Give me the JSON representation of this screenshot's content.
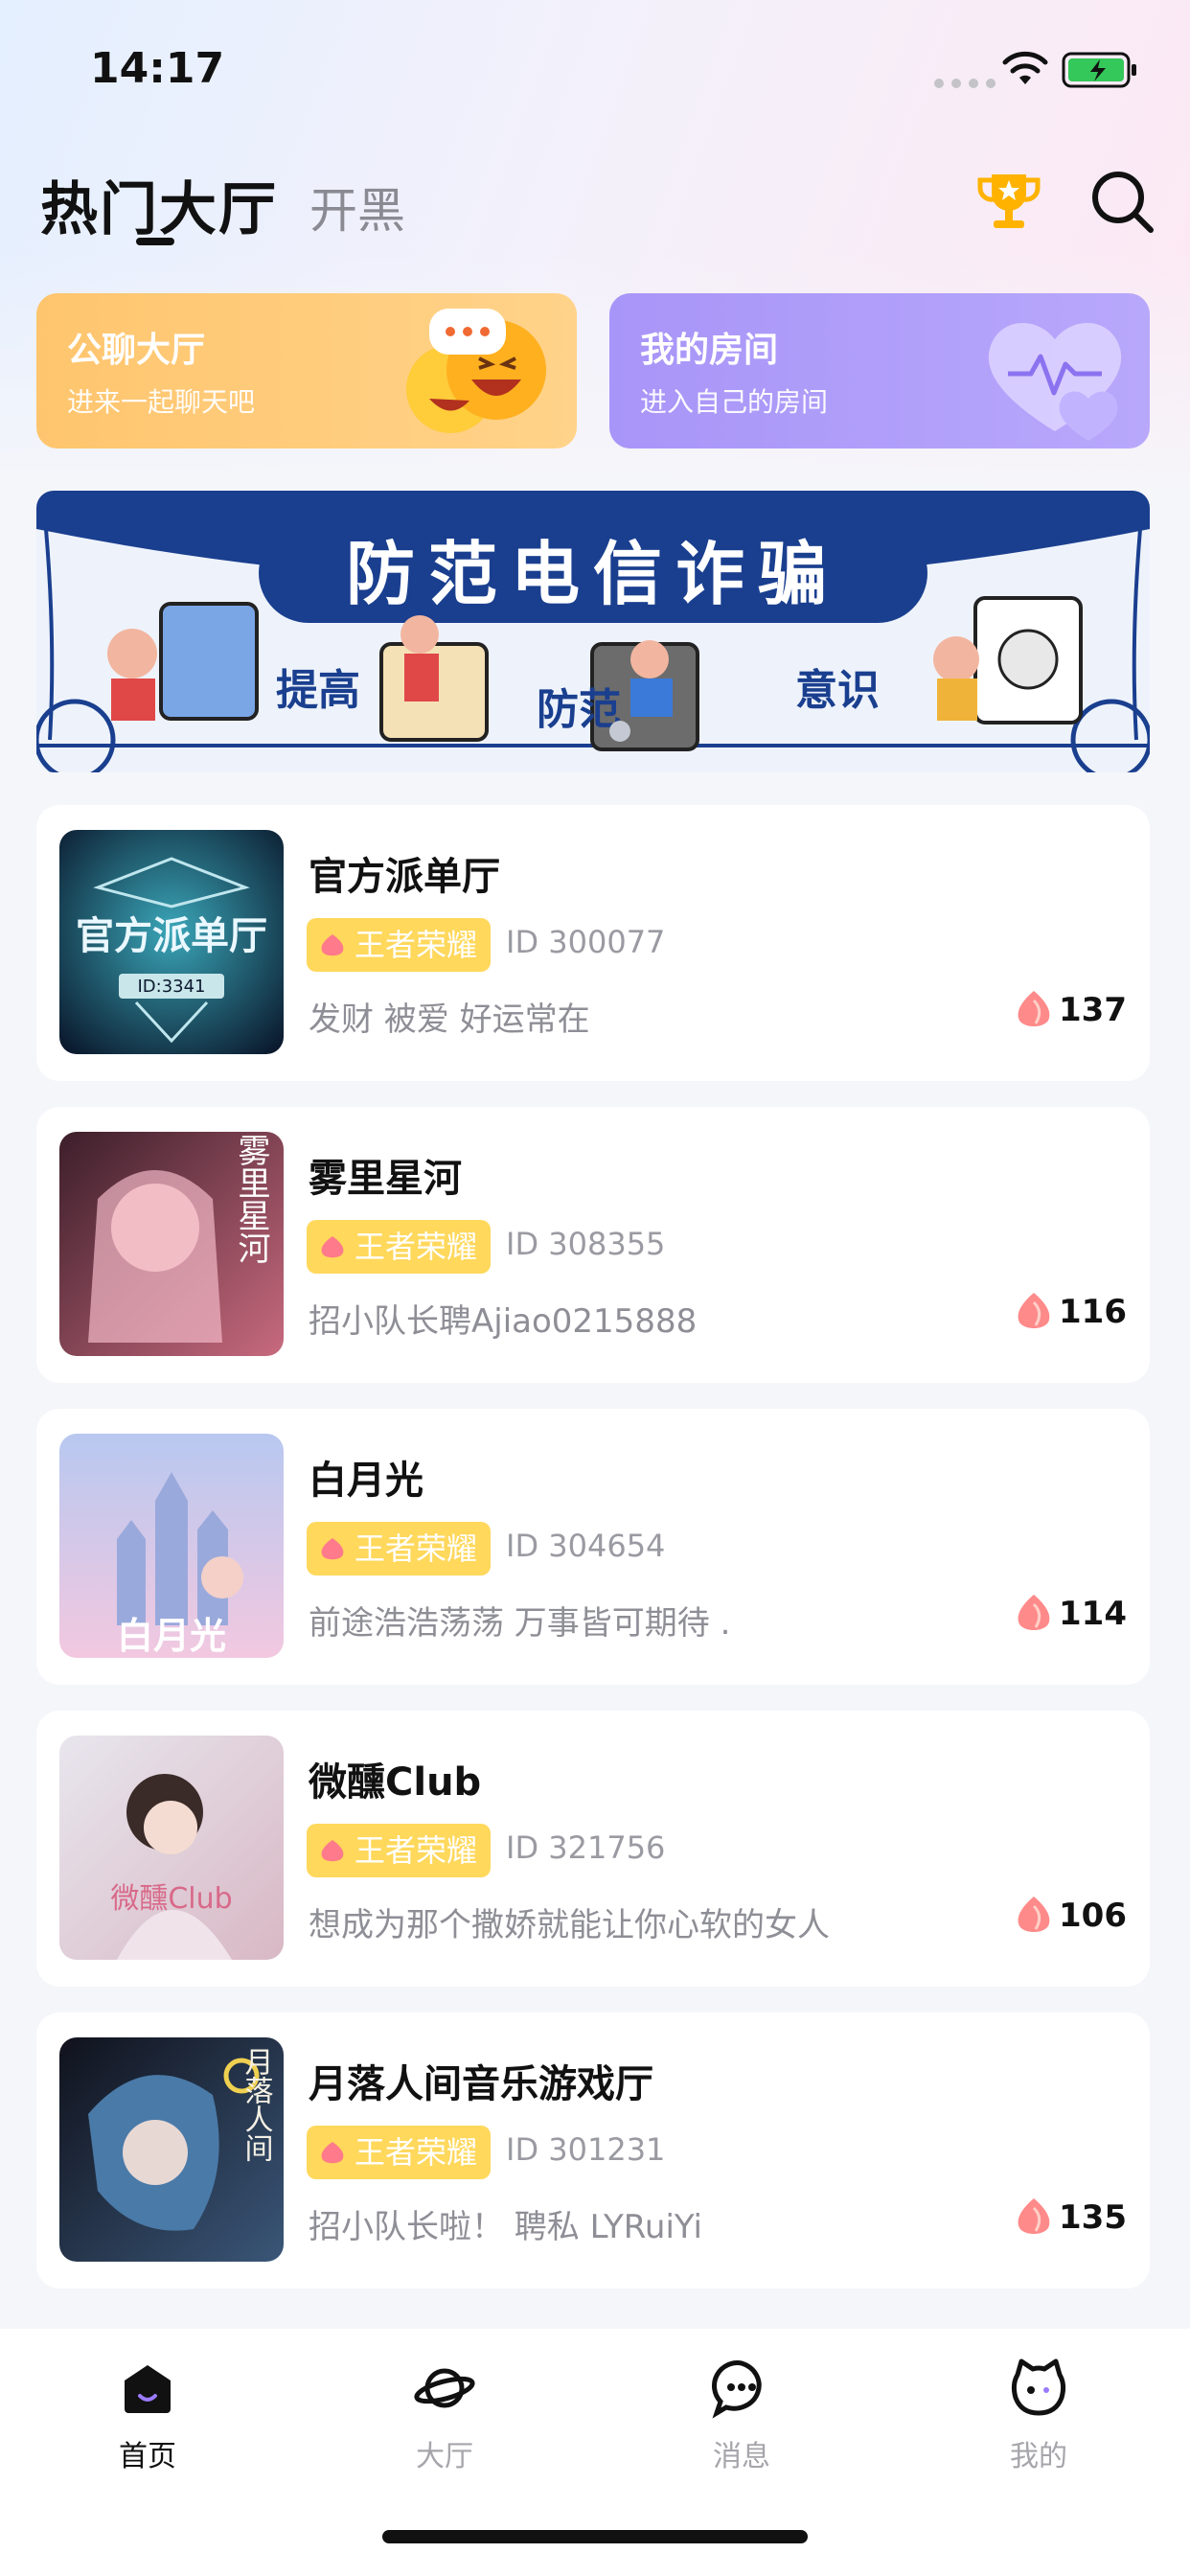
{
  "status_bar": {
    "time": "14:17"
  },
  "header": {
    "tabs": [
      {
        "label": "热门大厅",
        "active": true
      },
      {
        "label": "开黑",
        "active": false
      }
    ],
    "trophy_icon": "trophy-icon",
    "search_icon": "search-icon"
  },
  "cards": [
    {
      "title": "公聊大厅",
      "subtitle": "进来一起聊天吧",
      "color": "#ffc56e"
    },
    {
      "title": "我的房间",
      "subtitle": "进入自己的房间",
      "color": "#a895f8"
    }
  ],
  "banner": {
    "title": "防范电信诈骗",
    "words": [
      "提高",
      "防范",
      "意识"
    ],
    "accent": "#1a3f8f"
  },
  "rooms": [
    {
      "name": "官方派单厅",
      "tag": "王者荣耀",
      "id": "ID 300077",
      "desc": "发财 被爱 好运常在",
      "heat": "137",
      "thumb_text": "官方派单厅",
      "thumb_id": "ID:3341"
    },
    {
      "name": "雾里星河",
      "tag": "王者荣耀",
      "id": "ID 308355",
      "desc": "招小队长聘Ajiao0215888",
      "heat": "116",
      "thumb_text": "雾里星河"
    },
    {
      "name": "白月光",
      "tag": "王者荣耀",
      "id": "ID 304654",
      "desc": "前途浩浩荡荡 万事皆可期待 .",
      "heat": "114",
      "thumb_text": "白月光"
    },
    {
      "name": "微醺Club",
      "tag": "王者荣耀",
      "id": "ID 321756",
      "desc": "想成为那个撒娇就能让你心软的女人",
      "heat": "106",
      "thumb_text": "微醺Club"
    },
    {
      "name": "月落人间音乐游戏厅",
      "tag": "王者荣耀",
      "id": "ID 301231",
      "desc": "招小队长啦！ 聘私 LYRuiYi",
      "heat": "135",
      "thumb_text": "月落人间"
    }
  ],
  "bottom_nav": [
    {
      "label": "首页",
      "icon": "home-icon",
      "active": true
    },
    {
      "label": "大厅",
      "icon": "planet-icon",
      "active": false
    },
    {
      "label": "消息",
      "icon": "chat-icon",
      "active": false
    },
    {
      "label": "我的",
      "icon": "cat-face-icon",
      "active": false
    }
  ]
}
